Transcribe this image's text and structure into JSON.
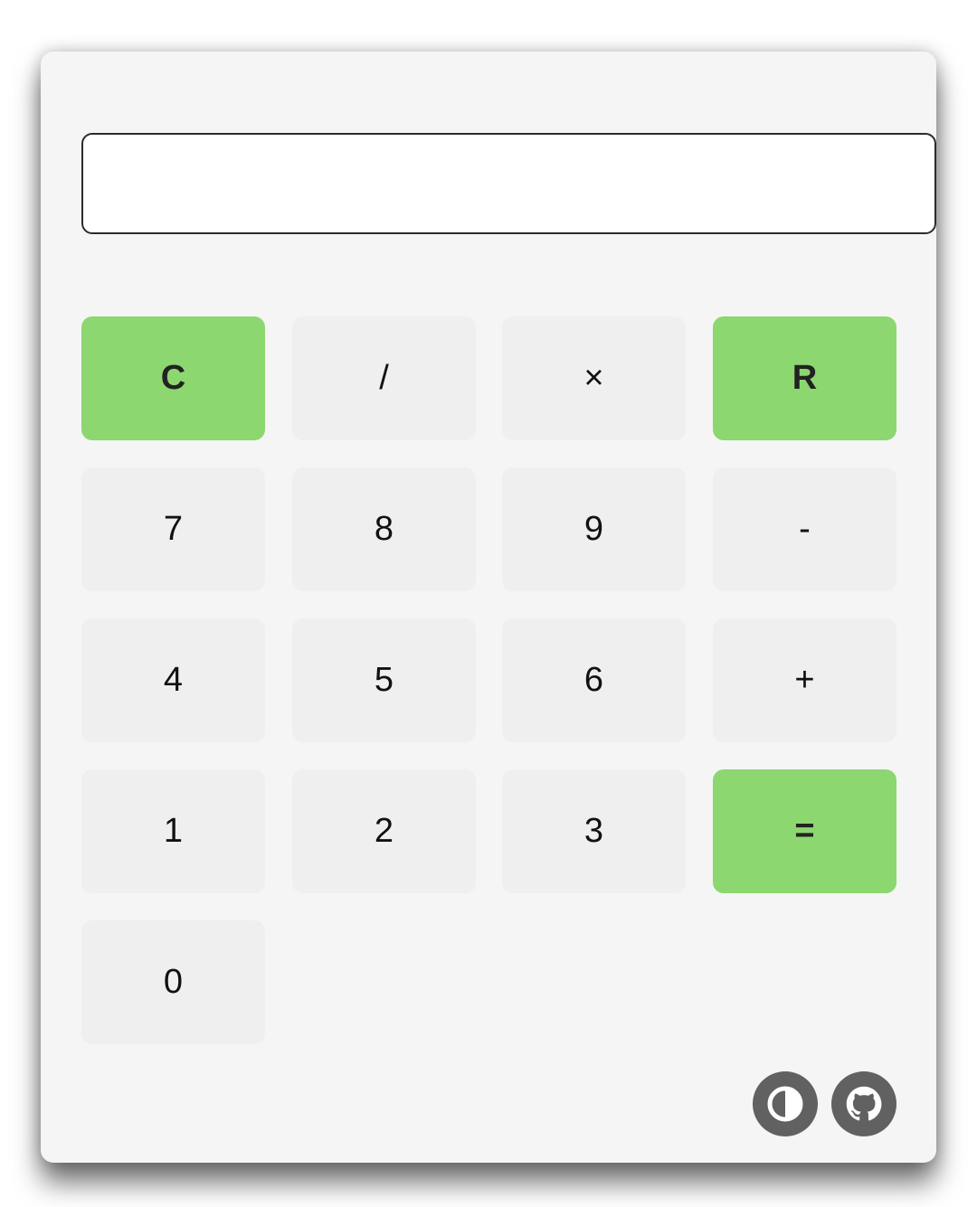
{
  "display": {
    "value": ""
  },
  "keys": {
    "clear": "C",
    "divide": "/",
    "multiply": "×",
    "reset": "R",
    "seven": "7",
    "eight": "8",
    "nine": "9",
    "minus": "-",
    "four": "4",
    "five": "5",
    "six": "6",
    "plus": "+",
    "one": "1",
    "two": "2",
    "three": "3",
    "equals": "=",
    "zero": "0"
  },
  "footer": {
    "theme_icon": "contrast-icon",
    "github_icon": "github-icon"
  },
  "colors": {
    "accent": "#8cd76f",
    "key_background": "#efefef",
    "card_background": "#f5f5f5",
    "icon_button": "#616161"
  }
}
